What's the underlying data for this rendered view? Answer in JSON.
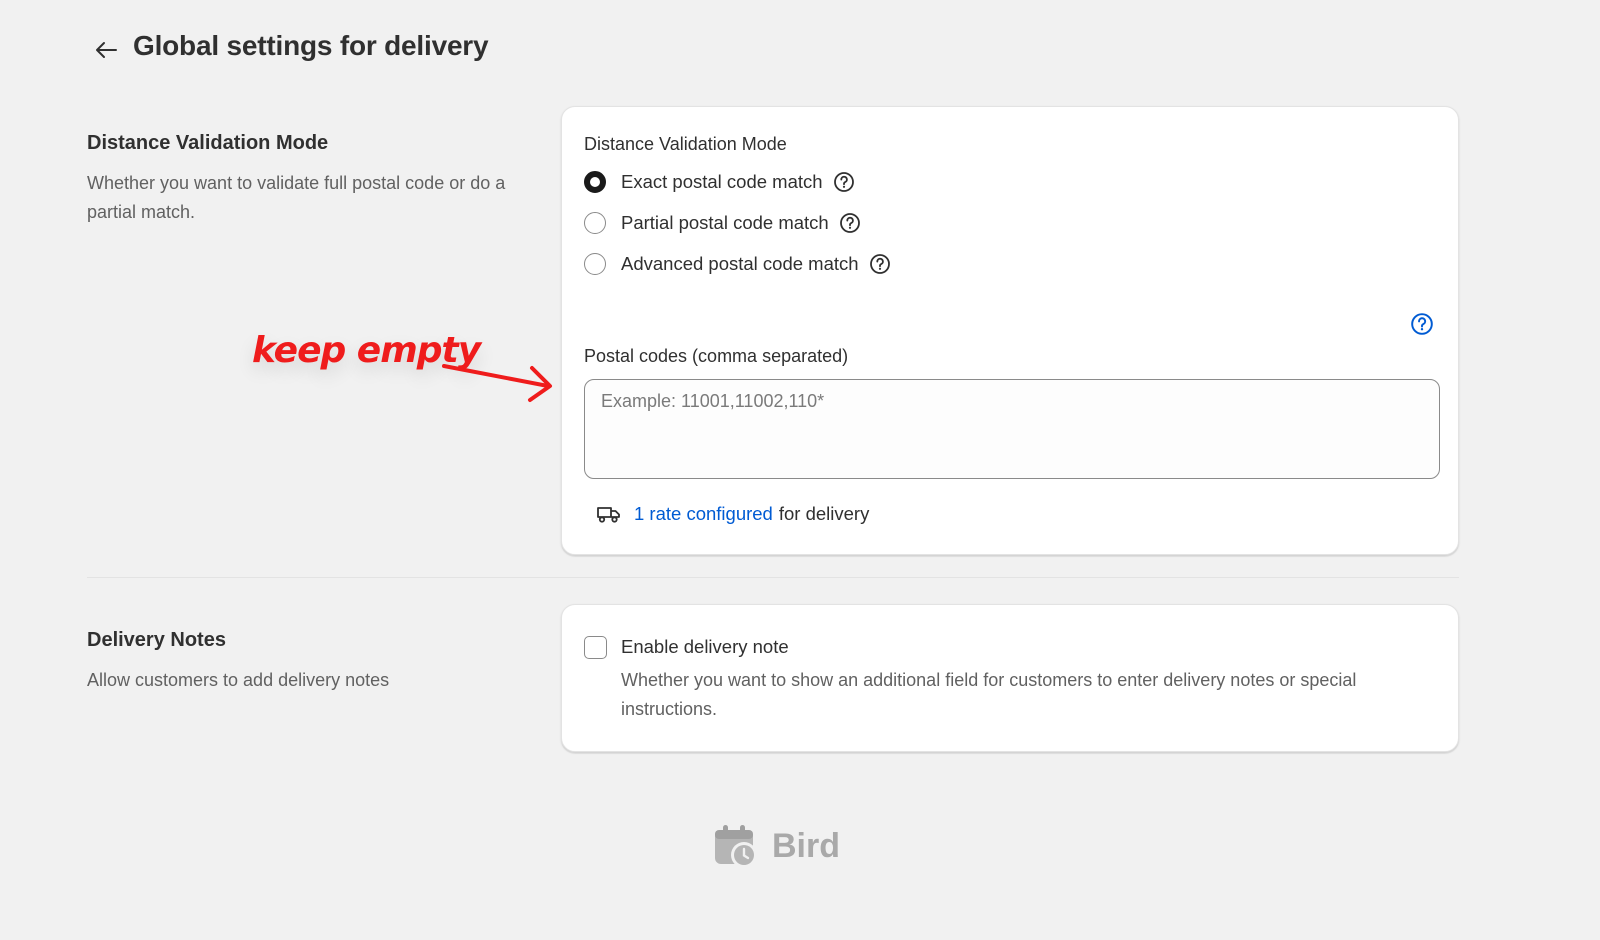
{
  "header": {
    "title": "Global settings for delivery"
  },
  "sections": {
    "distance": {
      "title": "Distance Validation Mode",
      "description": "Whether you want to validate full postal code or do a partial match.",
      "card": {
        "label": "Distance Validation Mode",
        "options": [
          {
            "label": "Exact postal code match",
            "selected": true
          },
          {
            "label": "Partial postal code match",
            "selected": false
          },
          {
            "label": "Advanced postal code match",
            "selected": false
          }
        ],
        "postal_codes_label": "Postal codes (comma separated)",
        "postal_codes_placeholder": "Example: 11001,11002,110*",
        "postal_codes_value": "",
        "rate_link": "1 rate configured",
        "rate_suffix": "for delivery"
      }
    },
    "notes": {
      "title": "Delivery Notes",
      "description": "Allow customers to add delivery notes",
      "card": {
        "checkbox_label": "Enable delivery note",
        "checkbox_checked": false,
        "help_text": "Whether you want to show an additional field for customers to enter delivery notes or special instructions."
      }
    }
  },
  "annotation": {
    "text": "keep empty",
    "color": "#ef1c1c"
  },
  "footer": {
    "logo_text": "Bird"
  },
  "icons": {
    "back": "arrow-left-icon",
    "help": "question-circle-icon",
    "truck": "truck-icon",
    "logo": "calendar-clock-icon"
  },
  "colors": {
    "link": "#005bd3",
    "background": "#f1f1f1",
    "card": "#ffffff"
  }
}
